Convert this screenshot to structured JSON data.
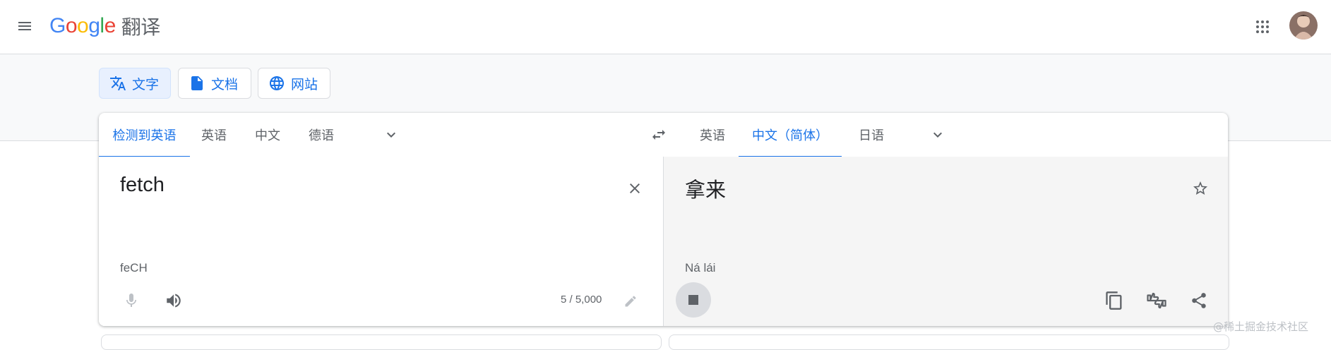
{
  "header": {
    "logo_letters": [
      "G",
      "o",
      "o",
      "g",
      "l",
      "e"
    ],
    "product": "翻译",
    "menu_icon": "hamburger-menu-icon",
    "apps_icon": "apps-grid-icon"
  },
  "modes": [
    {
      "label": "文字",
      "icon": "translate-icon",
      "active": true
    },
    {
      "label": "文档",
      "icon": "document-icon",
      "active": false
    },
    {
      "label": "网站",
      "icon": "globe-icon",
      "active": false
    }
  ],
  "source_langs": [
    "检测到英语",
    "英语",
    "中文",
    "德语"
  ],
  "target_langs": [
    "英语",
    "中文（简体）",
    "日语"
  ],
  "source": {
    "text": "fetch",
    "transliteration": "feCH",
    "char_count": "5 / 5,000"
  },
  "target": {
    "text": "拿来",
    "transliteration": "Ná lái"
  },
  "colors": {
    "accent": "#1a73e8",
    "text": "#202124",
    "muted": "#5f6368",
    "border": "#dadce0",
    "target_bg": "#f5f5f5"
  },
  "watermark": "@稀土掘金技术社区"
}
